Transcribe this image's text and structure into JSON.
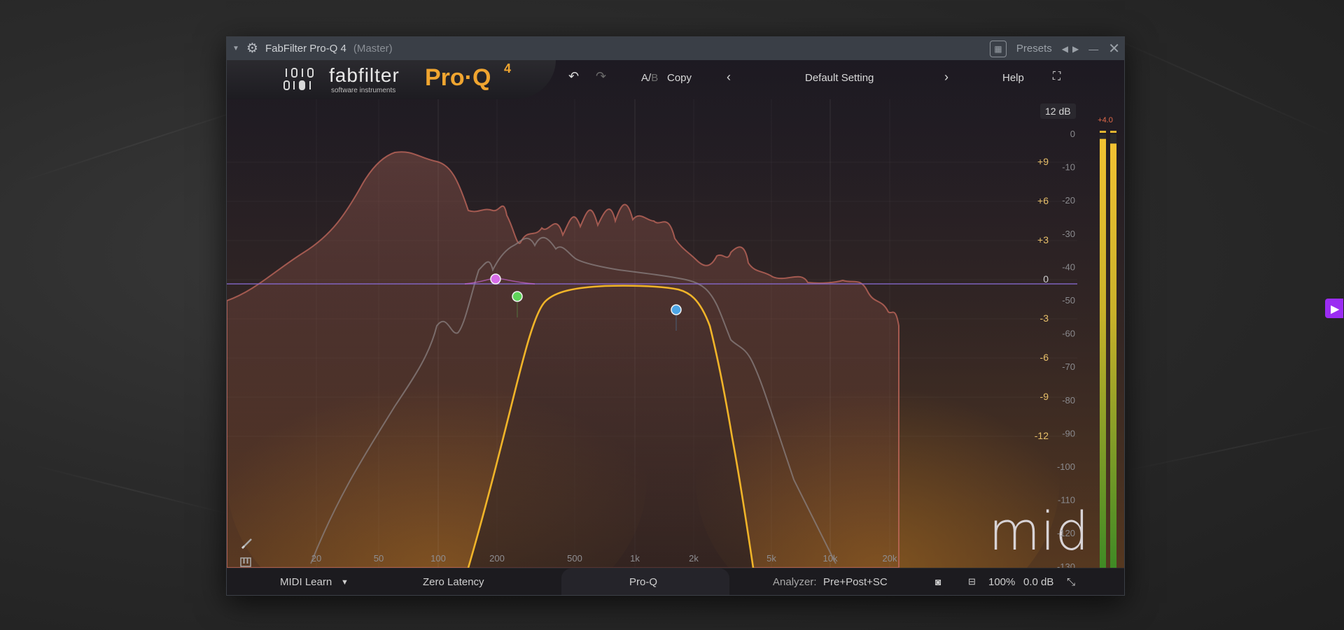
{
  "window": {
    "title": "FabFilter Pro-Q 4",
    "title_suffix": "(Master)",
    "presets_label": "Presets"
  },
  "header": {
    "brand": "fabfilter",
    "brand_sub": "software instruments",
    "product": "Pro·Q",
    "product_version": "4",
    "ab_a": "A/",
    "ab_b": "B",
    "copy_label": "Copy",
    "preset_name": "Default Setting",
    "help_label": "Help",
    "range_label": "12 dB"
  },
  "eq_scale": [
    "+9",
    "+6",
    "+3",
    "0",
    "-3",
    "-6",
    "-9",
    "-12"
  ],
  "analyzer_scale": [
    "0",
    "-10",
    "-20",
    "-30",
    "-40",
    "-50",
    "-60",
    "-70",
    "-80",
    "-90",
    "-100",
    "-110",
    "-120",
    "-130"
  ],
  "meter": {
    "peak_label": "+4.0",
    "level_left": 0.99,
    "level_right": 0.98
  },
  "freq_labels": [
    "20",
    "50",
    "100",
    "200",
    "500",
    "1k",
    "2k",
    "5k",
    "10k",
    "20k"
  ],
  "bands": [
    {
      "type": "bell",
      "freq": "200 Hz",
      "color": "#d86ce8"
    },
    {
      "type": "high-pass",
      "freq": "230 Hz",
      "color": "#5fd35a"
    },
    {
      "type": "low-pass",
      "freq": "2.1 kHz",
      "color": "#4da6e6"
    }
  ],
  "mode_label": "mid",
  "footer": {
    "midi_learn": "MIDI Learn",
    "latency": "Zero Latency",
    "center_tab": "Pro-Q",
    "analyzer_label": "Analyzer:",
    "analyzer_value": "Pre+Post+SC",
    "zoom": "100%",
    "output_gain": "0.0 dB"
  },
  "colors": {
    "eq_curve": "#f0b429",
    "spectrum_pre": "#c66a5e",
    "spectrum_post": "#8a8080",
    "meter": "#e0b430",
    "zero_line": "#8b6cd8",
    "accent_purple": "#9b2cf2"
  }
}
